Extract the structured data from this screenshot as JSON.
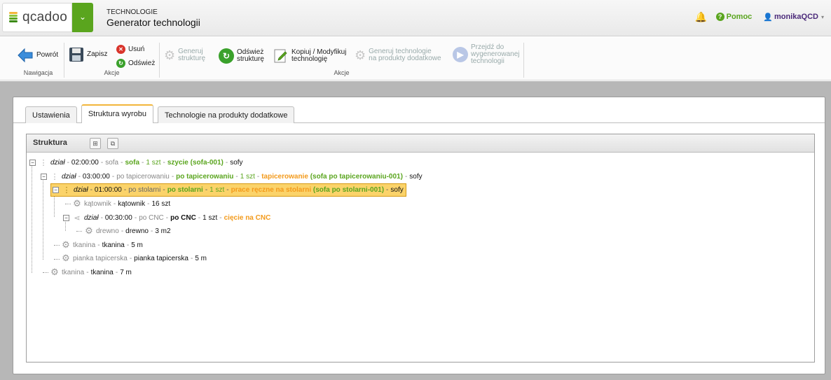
{
  "header": {
    "logo_text": "qcadoo",
    "subtitle": "TECHNOLOGIE",
    "title": "Generator technologii",
    "help_label": "Pomoc",
    "user_label": "monikaQCD"
  },
  "ribbon": {
    "nav_group_label": "Nawigacja",
    "back_label": "Powrót",
    "akcje1_label": "Akcje",
    "save_label": "Zapisz",
    "delete_label": "Usuń",
    "refresh_label": "Odśwież",
    "akcje2_label": "Akcje",
    "gen_structure_1": "Generuj",
    "gen_structure_2": "strukturę",
    "refresh_structure_1": "Odśwież",
    "refresh_structure_2": "strukturę",
    "copy_modify_1": "Kopiuj / Modyfikuj",
    "copy_modify_2": "technologię",
    "gen_tech_1": "Generuj technologie",
    "gen_tech_2": "na produkty dodatkowe",
    "goto_1": "Przejdź do",
    "goto_2": "wygenerowanej",
    "goto_3": "technologii"
  },
  "tabs": [
    "Ustawienia",
    "Struktura wyrobu",
    "Technologie na produkty dodatkowe"
  ],
  "tree": {
    "title": "Struktura",
    "rows": [
      {
        "a": "dział",
        "b": "02:00:00",
        "c": "sofa",
        "d": "sofa",
        "e": "1 szt",
        "f": "szycie (sofa-001)",
        "g": "sofy"
      },
      {
        "a": "dział",
        "b": "03:00:00",
        "c": "po tapicerowaniu",
        "d": "po tapicerowaniu",
        "e": "1 szt",
        "f": "tapicerowanie",
        "f2": "(sofa po tapicerowaniu-001)",
        "g": "sofy"
      },
      {
        "a": "dział",
        "b": "01:00:00",
        "c": "po stolarni",
        "d": "po stolarni",
        "e": "1 szt",
        "f": "prace ręczne na stolarni",
        "f2": "(sofa po stolarni-001)",
        "g": "sofy"
      },
      {
        "a": "kątownik",
        "b": "kątownik",
        "c": "16 szt"
      },
      {
        "a": "dział",
        "b": "00:30:00",
        "c": "po CNC",
        "d": "po CNC",
        "e": "1 szt",
        "f": "cięcie na CNC"
      },
      {
        "a": "drewno",
        "b": "drewno",
        "c": "3 m2"
      },
      {
        "a": "tkanina",
        "b": "tkanina",
        "c": "5 m"
      },
      {
        "a": "pianka tapicerska",
        "b": "pianka tapicerska",
        "c": "5 m"
      },
      {
        "a": "tkanina",
        "b": "tkanina",
        "c": "7 m"
      }
    ]
  },
  "colors": {
    "brand_green": "#5aa51e",
    "orange": "#f39a1b",
    "selected": "#fbd36a"
  }
}
